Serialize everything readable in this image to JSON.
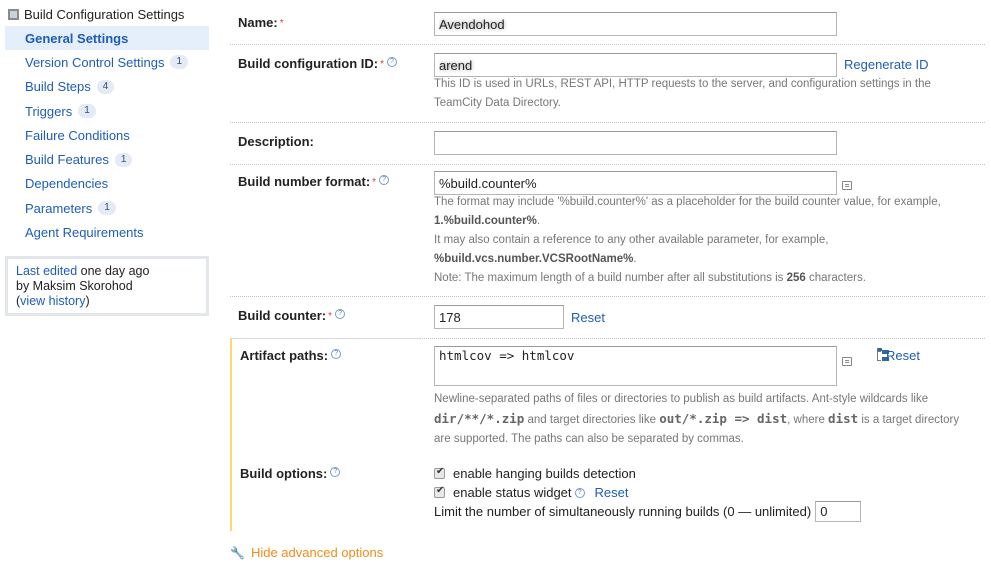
{
  "sidebar": {
    "header": "Build Configuration Settings",
    "items": [
      {
        "label": "General Settings",
        "badge": null,
        "active": true
      },
      {
        "label": "Version Control Settings",
        "badge": "1"
      },
      {
        "label": "Build Steps",
        "badge": "4"
      },
      {
        "label": "Triggers",
        "badge": "1"
      },
      {
        "label": "Failure Conditions",
        "badge": null
      },
      {
        "label": "Build Features",
        "badge": "1"
      },
      {
        "label": "Dependencies",
        "badge": null
      },
      {
        "label": "Parameters",
        "badge": "1"
      },
      {
        "label": "Agent Requirements",
        "badge": null
      }
    ],
    "edited": {
      "link": "Last edited",
      "when": " one day ago",
      "by": "by Maksim Skorohod",
      "open": "(",
      "history_link": "view history",
      "close": ")"
    }
  },
  "form": {
    "name": {
      "label": "Name:",
      "value": "Avendohod"
    },
    "config_id": {
      "label": "Build configuration ID:",
      "value": "arend",
      "regenerate": "Regenerate ID",
      "note": "This ID is used in URLs, REST API, HTTP requests to the server, and configuration settings in the TeamCity Data Directory."
    },
    "description": {
      "label": "Description:",
      "value": ""
    },
    "build_number_format": {
      "label": "Build number format:",
      "value": "%build.counter%",
      "note1": "The format may include '%build.counter%' as a placeholder for the build counter value, for example,",
      "note1_bold": "1.%build.counter%",
      "note2": "It may also contain a reference to any other available parameter, for example,",
      "note2_bold": "%build.vcs.number.VCSRootName%",
      "note3_pre": "Note: The maximum length of a build number after all substitutions is ",
      "note3_bold": "256",
      "note3_post": " characters."
    },
    "build_counter": {
      "label": "Build counter:",
      "value": "178",
      "reset": "Reset"
    },
    "artifact_paths": {
      "label": "Artifact paths:",
      "value": "htmlcov => htmlcov",
      "reset": "Reset",
      "note_a": "Newline-separated paths of files or directories to publish as build artifacts. Ant-style wildcards like",
      "code1": "dir/**/*.zip",
      "note_b": " and target directories like ",
      "code2": "out/*.zip => dist",
      "note_c": ", where ",
      "code3": "dist",
      "note_d": " is a target directory",
      "note_e": "are supported. The paths can also be separated by commas."
    },
    "build_options": {
      "label": "Build options:",
      "hanging": {
        "label": "enable hanging builds detection",
        "checked": true
      },
      "status_widget": {
        "label": "enable status widget",
        "checked": true,
        "reset": "Reset"
      },
      "limit_label": "Limit the number of simultaneously running builds (0 — unlimited)",
      "limit_value": "0"
    }
  },
  "hide_advanced": "Hide advanced options",
  "colors": {
    "link": "#1f5cb8",
    "required": "#e03b3b",
    "advanced_bar": "#ffd86a",
    "hide_advanced": "#f08c1a"
  }
}
